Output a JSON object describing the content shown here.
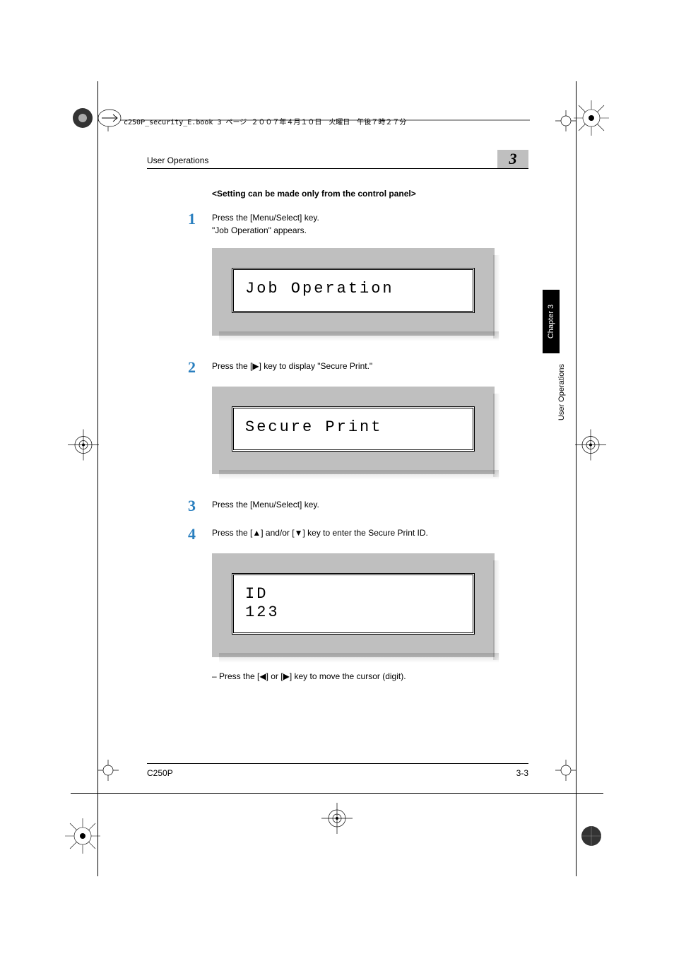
{
  "doc_header": "c250P_security_E.book  3 ページ  ２００７年４月１０日　火曜日　午後７時２７分",
  "running_head_title": "User Operations",
  "chapter_number": "3",
  "side_tab_black": "Chapter 3",
  "side_tab_label": "User Operations",
  "subhead": "<Setting can be made only from the control panel>",
  "steps": {
    "1": {
      "num": "1",
      "line1": "Press the [Menu/Select] key.",
      "line2": "\"Job Operation\" appears.",
      "lcd": "Job Operation"
    },
    "2": {
      "num": "2",
      "line1": "Press the [▶] key to display \"Secure Print.\"",
      "lcd": "Secure Print"
    },
    "3": {
      "num": "3",
      "line1": "Press the [Menu/Select] key."
    },
    "4": {
      "num": "4",
      "line1": "Press the [▲] and/or [▼] key to enter the Secure Print ID.",
      "lcd": "ID\n123"
    }
  },
  "subnote": "–    Press the [◀] or [▶] key to move the cursor (digit).",
  "footer_left": "C250P",
  "footer_right": "3-3"
}
